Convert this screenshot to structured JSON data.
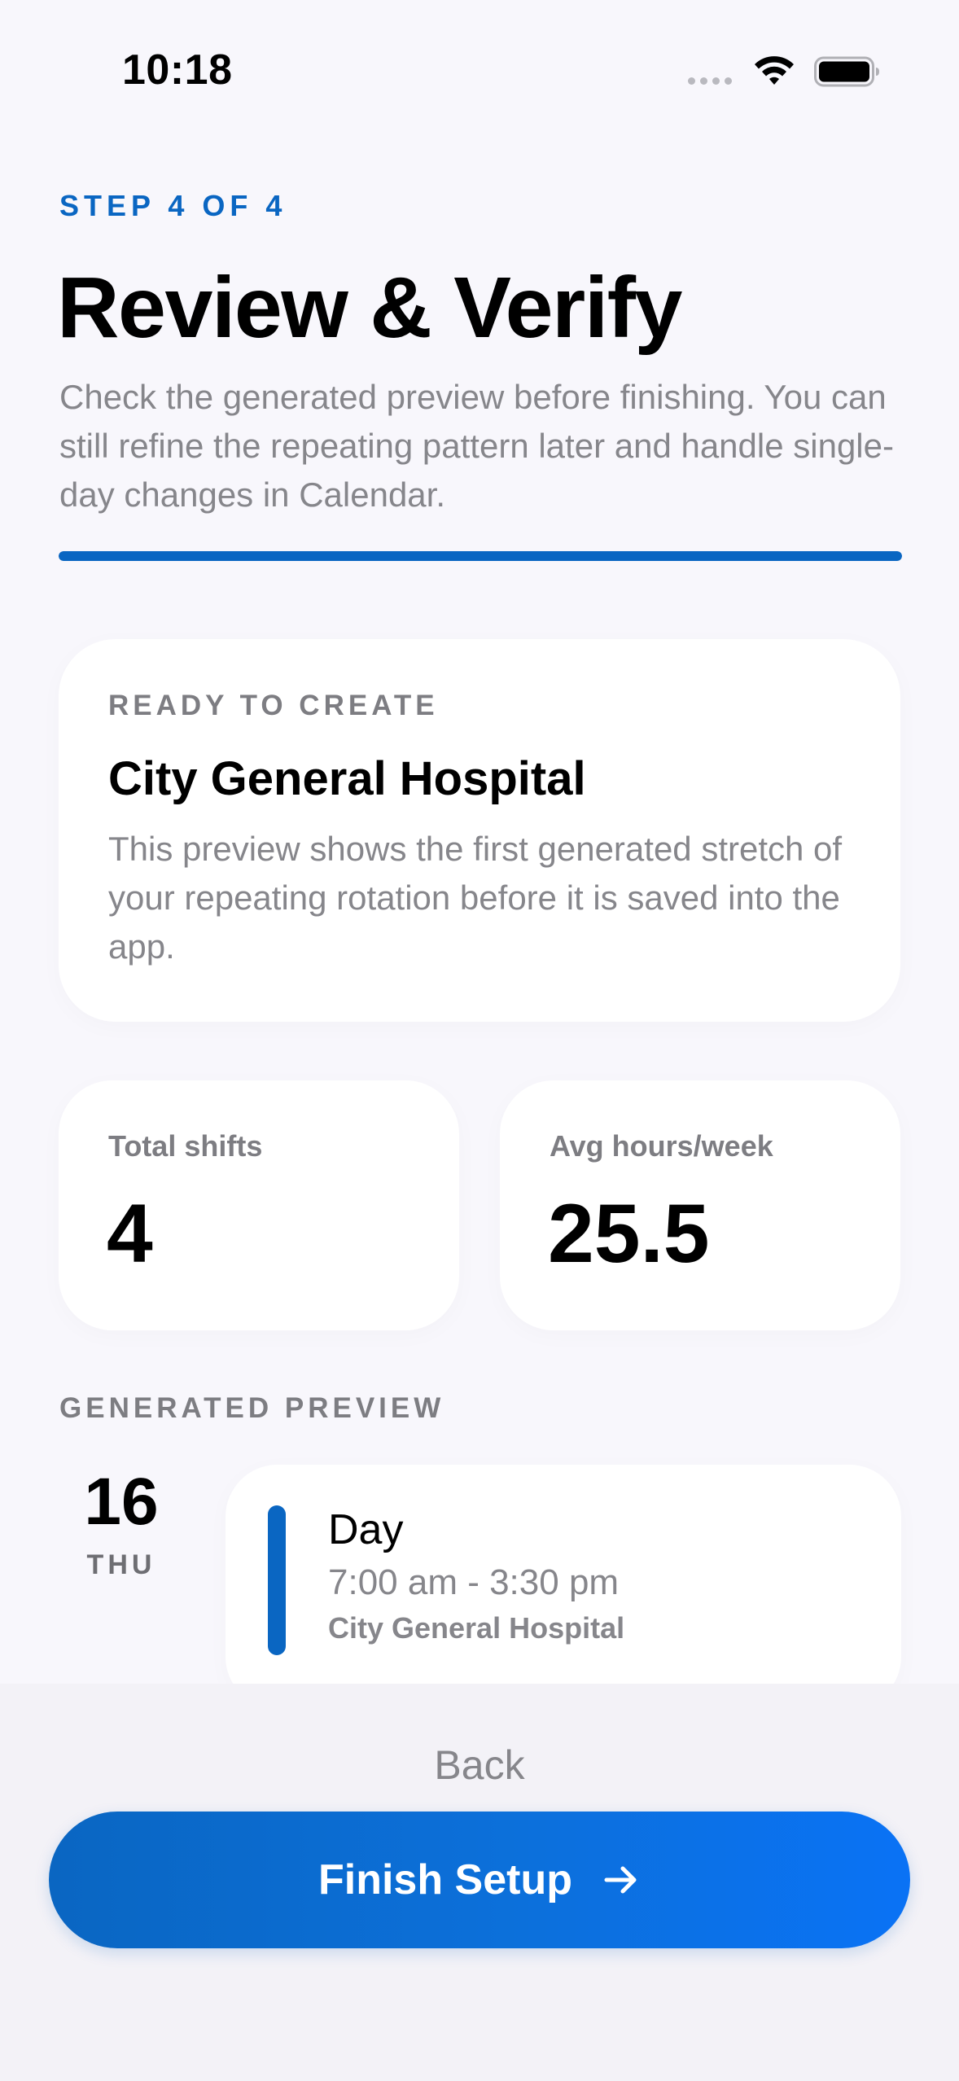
{
  "status_bar": {
    "time": "10:18",
    "icons": [
      "cellular-signal-icon",
      "wifi-icon",
      "battery-icon"
    ]
  },
  "header": {
    "step_label": "STEP 4 OF 4",
    "title": "Review & Verify",
    "subtitle": "Check the generated preview before finishing. You can still refine the repeating pattern later and handle single-day changes in Calendar.",
    "progress": 1.0
  },
  "summary_card": {
    "eyebrow": "READY TO CREATE",
    "title": "City General Hospital",
    "description": "This preview shows the first generated stretch of your repeating rotation before it is saved into the app."
  },
  "stats": {
    "total_shifts_label": "Total shifts",
    "total_shifts_value": "4",
    "avg_hours_label": "Avg hours/week",
    "avg_hours_value": "25.5"
  },
  "preview": {
    "heading": "GENERATED PREVIEW",
    "items": [
      {
        "date": "16",
        "weekday": "THU",
        "shift_name": "Day",
        "time": "7:00 am - 3:30 pm",
        "location": "City General Hospital"
      }
    ]
  },
  "actions": {
    "back_label": "Back",
    "finish_label": "Finish Setup",
    "finish_icon": "arrow-right-icon"
  },
  "colors": {
    "accent": "#0a66c2",
    "background": "#f8f7fc",
    "secondary_text": "#86868b"
  }
}
